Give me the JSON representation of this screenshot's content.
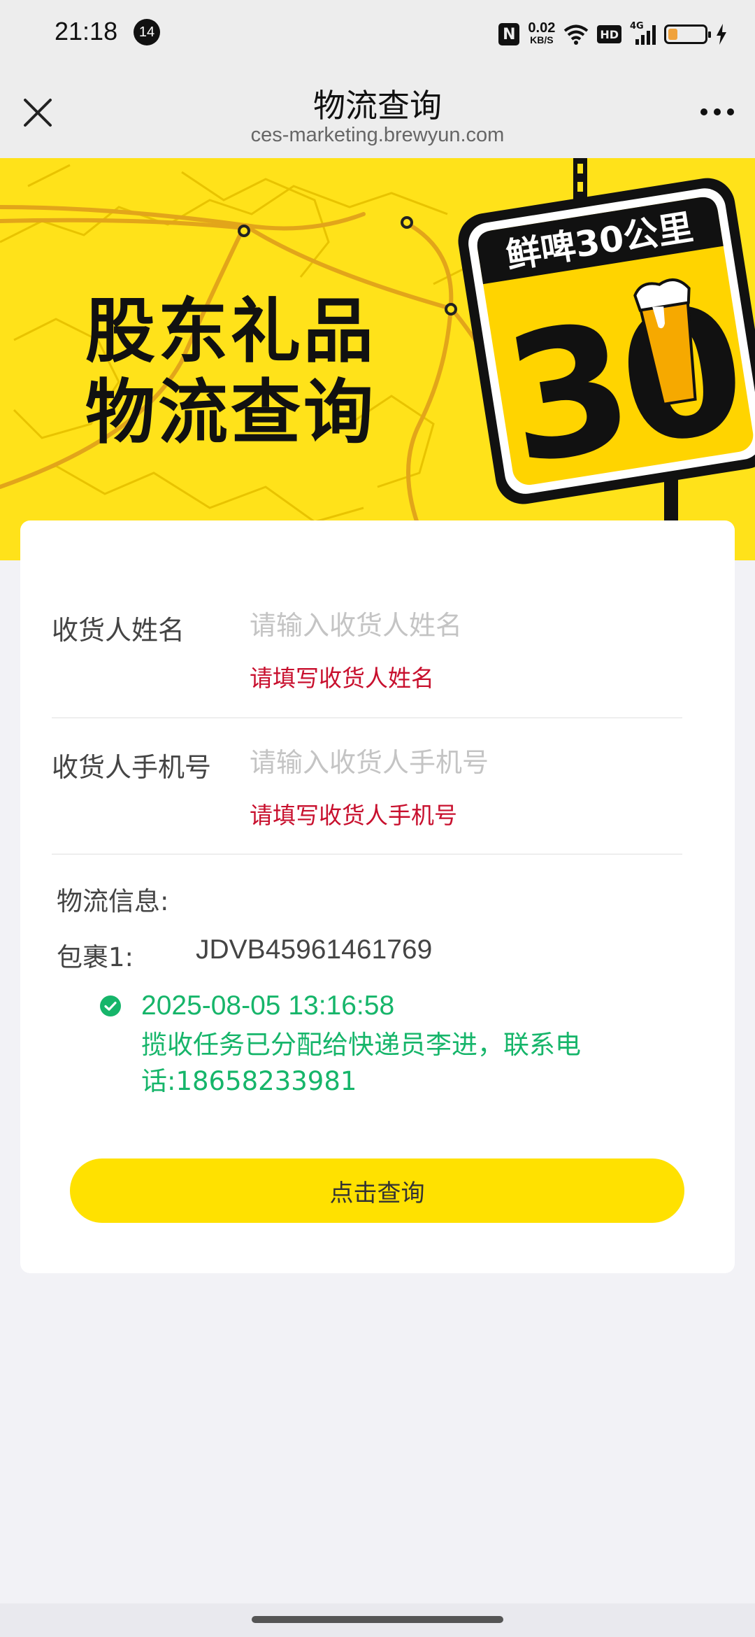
{
  "status_bar": {
    "time": "21:18",
    "notification_count": "14",
    "nfc": "N",
    "net_speed_value": "0.02",
    "net_speed_unit": "KB/S",
    "hd": "HD",
    "network": "4G",
    "battery_level": 0.25
  },
  "nav": {
    "title": "物流查询",
    "subtitle": "ces-marketing.brewyun.com"
  },
  "banner": {
    "title_line1": "股东礼品",
    "title_line2": "物流查询",
    "sign_text": "鲜啤30公里",
    "sign_number": "30",
    "colors": {
      "background": "#ffe21a",
      "sign": "#111111"
    }
  },
  "form": {
    "name": {
      "label": "收货人姓名",
      "placeholder": "请输入收货人姓名",
      "value": "",
      "error": "请填写收货人姓名"
    },
    "phone": {
      "label": "收货人手机号",
      "placeholder": "请输入收货人手机号",
      "value": "",
      "error": "请填写收货人手机号"
    }
  },
  "logistics": {
    "label": "物流信息:",
    "packages": [
      {
        "label": "包裹1:",
        "tracking_no": "JDVB45961461769",
        "events": [
          {
            "time": "2025-08-05 13:16:58",
            "description": "揽收任务已分配给快递员李进，联系电话:18658233981",
            "status_icon": "check-circle-icon"
          }
        ]
      }
    ]
  },
  "query_button": {
    "label": "点击查询"
  },
  "colors": {
    "accent": "#ffe100",
    "success": "#16b56a",
    "error": "#c8102e"
  }
}
